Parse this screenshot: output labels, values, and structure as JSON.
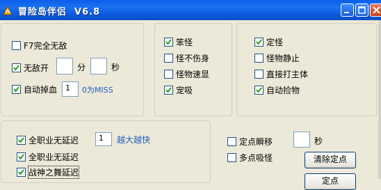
{
  "window": {
    "title": "冒险岛伴侣  V6.8",
    "icons": [
      "app-icon",
      "minimize-icon",
      "maximize-icon",
      "close-icon"
    ]
  },
  "group1": {
    "f7": {
      "label": "F7完全无敌",
      "checked": false
    },
    "invincible": {
      "label": "无敌开",
      "checked": true,
      "min_value": "",
      "min_unit": "分",
      "sec_value": "",
      "sec_unit": "秒"
    },
    "autodrop": {
      "label": "自动掉血",
      "checked": true,
      "value": "1",
      "hint": "0为MISS"
    }
  },
  "group2": {
    "items": [
      {
        "label": "笨怪",
        "checked": true
      },
      {
        "label": "怪不伤身",
        "checked": false
      },
      {
        "label": "怪物速显",
        "checked": false
      },
      {
        "label": "宠吸",
        "checked": true
      }
    ]
  },
  "group3": {
    "items": [
      {
        "label": "定怪",
        "checked": true
      },
      {
        "label": "怪物静止",
        "checked": false
      },
      {
        "label": "直接打主体",
        "checked": false
      },
      {
        "label": "自动捡物",
        "checked": true
      }
    ]
  },
  "group4": {
    "items": [
      {
        "label": "全职业无延迟",
        "checked": true
      },
      {
        "label": "全职业无延迟",
        "checked": true
      },
      {
        "label": "战神之舞延迟",
        "checked": true
      }
    ],
    "speed_value": "1",
    "speed_hint": "越大越快"
  },
  "right": {
    "teleport": {
      "label": "定点瞬移",
      "checked": false,
      "value": "",
      "unit": "秒"
    },
    "vacuum": {
      "label": "多点吸怪",
      "checked": false
    },
    "clear_button": "清除定点",
    "partial_button": "定点"
  },
  "colors": {
    "titlebar": "#0a5fe8",
    "face": "#ece9d8",
    "hint_text": "#2060c0",
    "checkmark": "#21a121"
  }
}
